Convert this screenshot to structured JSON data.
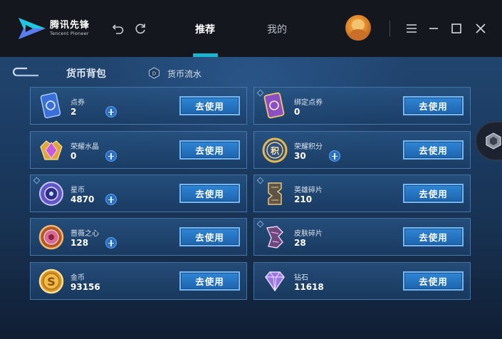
{
  "app": {
    "logo_cn": "腾讯先锋",
    "logo_en": "Tencent Pioneer"
  },
  "titlebar": {
    "tabs": [
      {
        "label": "推荐",
        "active": true
      },
      {
        "label": "我的",
        "active": false
      }
    ],
    "accent_color": "#19b6cf"
  },
  "section": {
    "title": "货币背包",
    "flow_link": "货币流水"
  },
  "currencies": [
    {
      "name": "点券",
      "amount": "2",
      "has_plus": true,
      "icon": "ticket-card-icon",
      "button": "去使用"
    },
    {
      "name": "绑定点券",
      "amount": "0",
      "has_plus": false,
      "icon": "bound-ticket-card-icon",
      "button": "去使用"
    },
    {
      "name": "荣耀水晶",
      "amount": "0",
      "has_plus": true,
      "icon": "glory-crystal-icon",
      "button": "去使用"
    },
    {
      "name": "荣耀积分",
      "amount": "30",
      "has_plus": true,
      "icon": "glory-points-icon",
      "button": "去使用"
    },
    {
      "name": "星币",
      "amount": "4870",
      "has_plus": true,
      "icon": "star-coin-icon",
      "button": "去使用"
    },
    {
      "name": "英雄碎片",
      "amount": "210",
      "has_plus": false,
      "icon": "hero-fragment-icon",
      "button": "去使用"
    },
    {
      "name": "蔷薇之心",
      "amount": "128",
      "has_plus": true,
      "icon": "rose-heart-icon",
      "button": "去使用"
    },
    {
      "name": "皮肤碎片",
      "amount": "28",
      "has_plus": false,
      "icon": "skin-fragment-icon",
      "button": "去使用"
    },
    {
      "name": "金币",
      "amount": "93156",
      "has_plus": false,
      "icon": "gold-coin-icon",
      "button": "去使用"
    },
    {
      "name": "钻石",
      "amount": "11618",
      "has_plus": false,
      "icon": "diamond-icon",
      "button": "去使用"
    }
  ]
}
